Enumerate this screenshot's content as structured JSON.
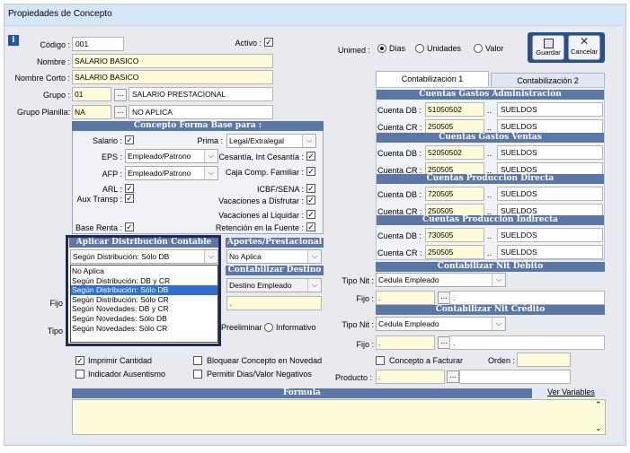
{
  "window": {
    "title": "Propiedades de Concepto"
  },
  "header": {
    "codigo_label": "Código :",
    "codigo_value": "001",
    "activo_label": "Activo :",
    "nombre_label": "Nombre :",
    "nombre_value": "SALARIO BASICO",
    "nombre_corto_label": "Nombre Corto :",
    "nombre_corto_value": "SALARIO BASICO",
    "grupo_label": "Grupo :",
    "grupo_code": "01",
    "grupo_name": "SALARIO PRESTACIONAL",
    "grupo_planilla_label": "Grupo Planilla:",
    "grupo_planilla_code": "NA",
    "grupo_planilla_name": "NO APLICA",
    "unimed_label": "Unimed :",
    "unimed_options": [
      "Dias",
      "Unidades",
      "Valor"
    ],
    "unimed_selected": "Dias"
  },
  "toolbar": {
    "guardar": "Guardar",
    "cancelar": "Cancelar"
  },
  "forma_base": {
    "title": "Concepto Forma Base para :",
    "salario": "Salario :",
    "prima": "Prima :",
    "prima_value": "Legal/Extralegal",
    "eps": "EPS :",
    "eps_value": "Empleado/Patrono",
    "cesantia": "Cesantía, Int Cesantía :",
    "afp": "AFP :",
    "afp_value": "Empleado/Patrono",
    "caja": "Caja Comp. Familiar :",
    "arl": "ARL :",
    "icbf": "ICBF/SENA :",
    "aux": "Aux Transp :",
    "vac_disfrutar": "Vacaciones a Disfrutar :",
    "vac_liquidar": "Vacaciones al Liquidar :",
    "base_renta": "Base Renta :",
    "retencion": "Retención en la Fuente :"
  },
  "distribucion": {
    "title": "Aplicar Distribución Contable",
    "selected": "Según Distribución: Sólo DB",
    "options": [
      "No Aplica",
      "Según Distribución: DB y CR",
      "Según Distribución: Sólo DB",
      "Según Distribución: Sólo CR",
      "Según Novedades: DB y CR",
      "Según Novedades: Sólo DB",
      "Según Novedades: Sólo CR"
    ]
  },
  "aportes": {
    "title": "Aportes/Prestacional",
    "value": "No Aplica"
  },
  "contabilizar_destino": {
    "title": "Contabilizar Destino",
    "value": "Destino Empleado",
    "field": "."
  },
  "hidden_labels": {
    "fijo": "Fijo",
    "tipo": "Tipo"
  },
  "tipo_opts": {
    "preliminar": "Preeliminar",
    "informativo": "Informativo"
  },
  "tabs": [
    "Contabilización 1",
    "Contabilización 2"
  ],
  "cuentas": [
    {
      "title": "Cuentas Gastos Administración",
      "db": "51050502",
      "db_name": "SUELDOS",
      "cr": "250505",
      "cr_name": "SUELDOS"
    },
    {
      "title": "Cuentas Gastos Ventas",
      "db": "52050502",
      "db_name": "SUELDOS",
      "cr": "250505",
      "cr_name": "SUELDOS"
    },
    {
      "title": "Cuentas Producción Directa",
      "db": "720505",
      "db_name": "SUELDOS",
      "cr": "250505",
      "cr_name": "SUELDOS"
    },
    {
      "title": "Cuentas Producción Indirecta",
      "db": "730505",
      "db_name": "SUELDOS",
      "cr": "250505",
      "cr_name": "SUELDOS"
    }
  ],
  "cuenta_labels": {
    "db": "Cuenta DB :",
    "cr": "Cuenta CR :",
    "dots": ".."
  },
  "nit_debito": {
    "title": "Contabilizar Nit Débito",
    "tipo_label": "Tipo Nit :",
    "tipo_value": "Cedula Empleado",
    "fijo_label": "Fijo :",
    "fijo_value": ".",
    "fijo_name": "."
  },
  "nit_credito": {
    "title": "Contabilizar Nit Crédito",
    "tipo_label": "Tipo Nit :",
    "tipo_value": "Cedula Empleado",
    "fijo_label": "Fijo :",
    "fijo_value": ".",
    "fijo_name": "."
  },
  "options": {
    "imprimir": "Imprimir Cantidad",
    "bloquear": "Bloquear Concepto en Novedad",
    "concepto_facturar": "Concepto a Facturar",
    "orden": "Orden :",
    "ausentismo": "Indicador Ausentismo",
    "permitir": "Permitir Dias/Valor Negativos",
    "producto": "Producto :",
    "producto_value": "."
  },
  "formula": {
    "title": "Formula",
    "ver_variables": "Ver Variables"
  }
}
